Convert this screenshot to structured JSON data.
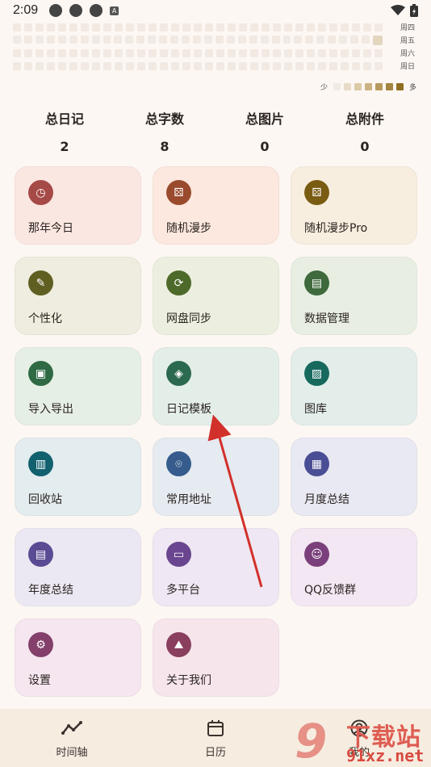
{
  "status_bar": {
    "time": "2:09",
    "icons": [
      "notification-icon",
      "notification-icon",
      "notification-icon",
      "app-icon"
    ],
    "right_icons": [
      "wifi-icon",
      "battery-icon"
    ]
  },
  "heatmap": {
    "days": [
      "周四",
      "周五",
      "周六",
      "周日"
    ],
    "legend_low": "少",
    "legend_high": "多",
    "legend_colors": [
      "#f1e9e2",
      "#e8dcc8",
      "#dccaa7",
      "#cbb283",
      "#b89a5e",
      "#a3853f",
      "#8f6f22"
    ]
  },
  "stats": [
    {
      "label": "总日记",
      "value": "2"
    },
    {
      "label": "总字数",
      "value": "8"
    },
    {
      "label": "总图片",
      "value": "0"
    },
    {
      "label": "总附件",
      "value": "0"
    }
  ],
  "cards": [
    {
      "label": "那年今日",
      "icon": "history-icon",
      "glyph": "◷",
      "bg": "#fbe7e2",
      "icon_bg": "#a64a47"
    },
    {
      "label": "随机漫步",
      "icon": "dice-icon",
      "glyph": "⚄",
      "bg": "#fce8df",
      "icon_bg": "#9a4a2d"
    },
    {
      "label": "随机漫步Pro",
      "icon": "dice-pro-icon",
      "glyph": "⚄",
      "bg": "#f7eedf",
      "icon_bg": "#7a5b12"
    },
    {
      "label": "个性化",
      "icon": "palette-icon",
      "glyph": "✎",
      "bg": "#eeeddf",
      "icon_bg": "#5f5f22"
    },
    {
      "label": "网盘同步",
      "icon": "sync-icon",
      "glyph": "⟳",
      "bg": "#ecefdf",
      "icon_bg": "#4e6a2a"
    },
    {
      "label": "数据管理",
      "icon": "sd-card-icon",
      "glyph": "▤",
      "bg": "#e8efe2",
      "icon_bg": "#3e6a3d"
    },
    {
      "label": "导入导出",
      "icon": "save-icon",
      "glyph": "▣",
      "bg": "#e6efe5",
      "icon_bg": "#2f6a45"
    },
    {
      "label": "日记模板",
      "icon": "widgets-icon",
      "glyph": "◈",
      "bg": "#e4eee8",
      "icon_bg": "#2c6a50"
    },
    {
      "label": "图库",
      "icon": "image-icon",
      "glyph": "▨",
      "bg": "#e3eeeb",
      "icon_bg": "#17695e"
    },
    {
      "label": "回收站",
      "icon": "trash-icon",
      "glyph": "▥",
      "bg": "#e3ecef",
      "icon_bg": "#11616f"
    },
    {
      "label": "常用地址",
      "icon": "location-icon",
      "glyph": "⌾",
      "bg": "#e6eaf1",
      "icon_bg": "#355c8c"
    },
    {
      "label": "月度总结",
      "icon": "calendar-icon",
      "glyph": "▦",
      "bg": "#e9e9f3",
      "icon_bg": "#4a4e94"
    },
    {
      "label": "年度总结",
      "icon": "document-icon",
      "glyph": "▤",
      "bg": "#ece8f3",
      "icon_bg": "#5b4b94"
    },
    {
      "label": "多平台",
      "icon": "devices-icon",
      "glyph": "▭",
      "bg": "#efe7f3",
      "icon_bg": "#69468f"
    },
    {
      "label": "QQ反馈群",
      "icon": "group-add-icon",
      "glyph": "☺",
      "bg": "#f2e7f2",
      "icon_bg": "#7b407c"
    },
    {
      "label": "设置",
      "icon": "gear-icon",
      "glyph": "⚙",
      "bg": "#f5e6ef",
      "icon_bg": "#843f6b"
    },
    {
      "label": "关于我们",
      "icon": "forest-icon",
      "glyph": "⛰",
      "bg": "#f6e6ec",
      "icon_bg": "#8a3f5e"
    }
  ],
  "bottom_nav": [
    {
      "label": "时间轴",
      "icon": "timeline-icon"
    },
    {
      "label": "日历",
      "icon": "calendar-icon"
    },
    {
      "label": "我的",
      "icon": "account-icon"
    }
  ],
  "watermark": {
    "big": "9",
    "text": "下载站",
    "url": "91xz.net"
  }
}
